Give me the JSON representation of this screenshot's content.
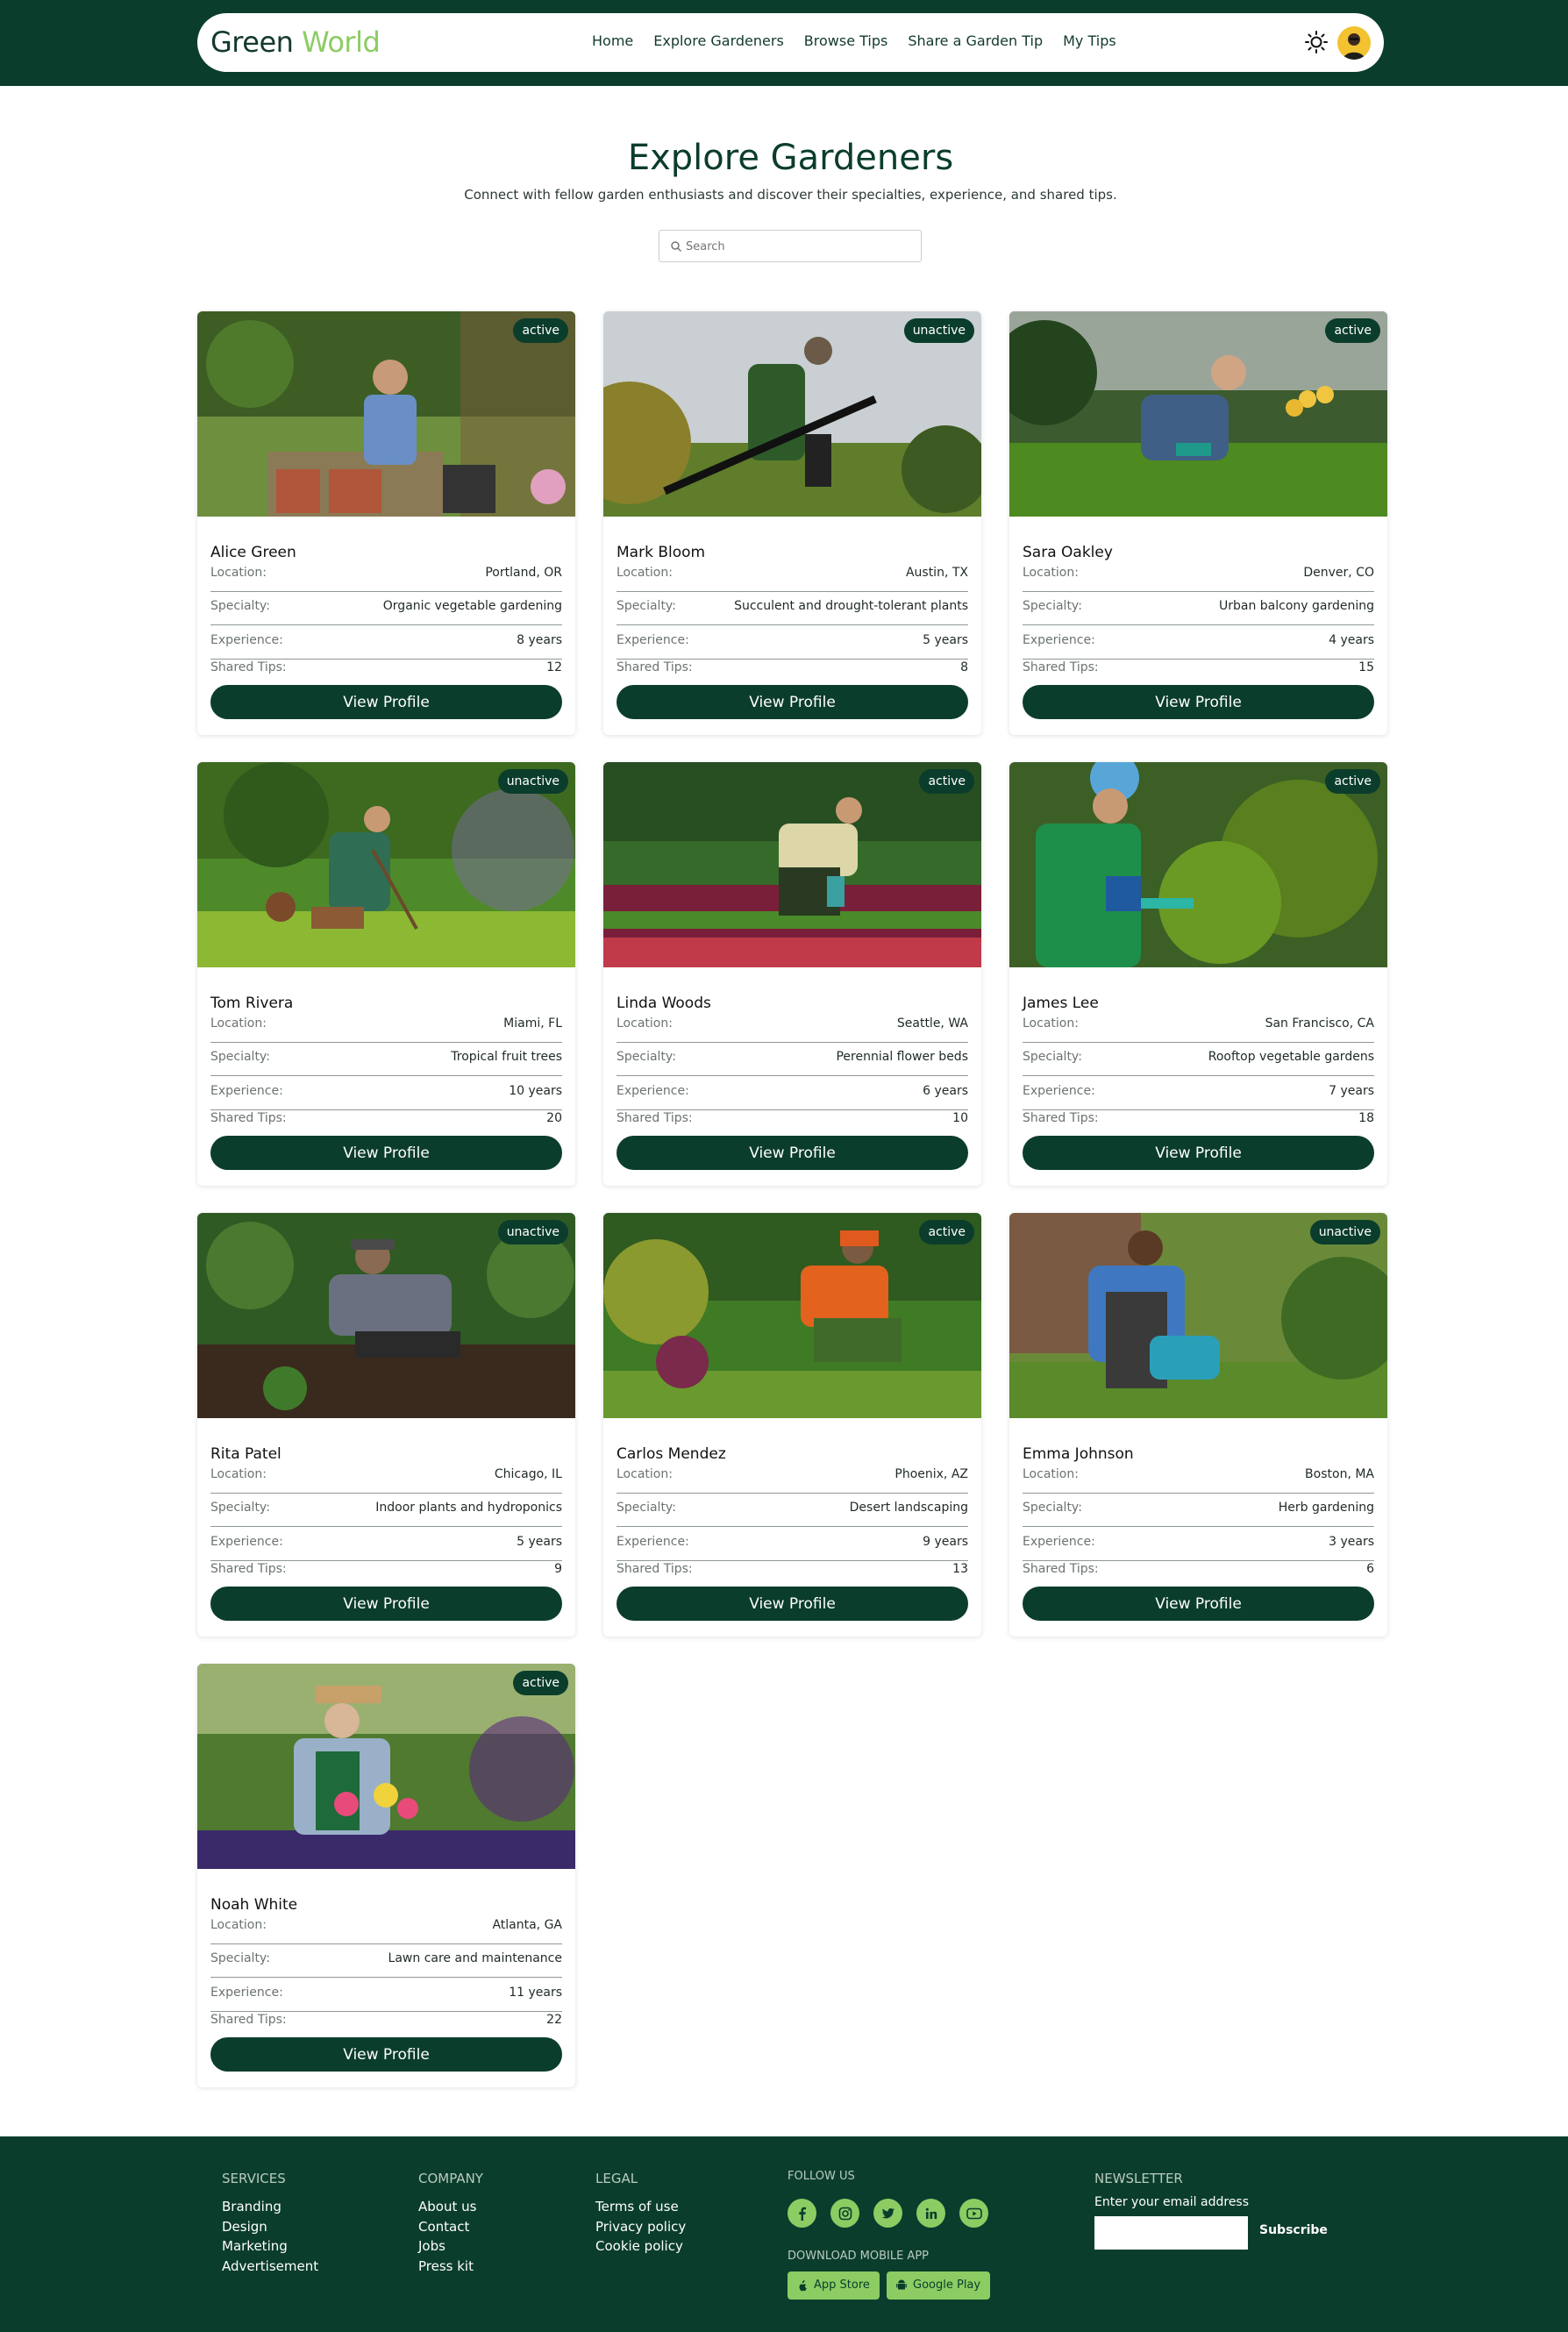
{
  "nav": {
    "logo_part1": "Green",
    "logo_part2": "World",
    "links": [
      "Home",
      "Explore Gardeners",
      "Browse Tips",
      "Share a Garden Tip",
      "My Tips"
    ],
    "theme_icon": "sun-icon",
    "avatar_icon": "user-avatar"
  },
  "header": {
    "title": "Explore Gardeners",
    "subtitle": "Connect with fellow garden enthusiasts and discover their specialties, experience, and shared tips.",
    "search_placeholder": "Search"
  },
  "labels": {
    "location": "Location:",
    "specialty": "Specialty:",
    "experience": "Experience:",
    "tips": "Shared Tips:",
    "button": "View Profile"
  },
  "gardeners": [
    {
      "name": "Alice Green",
      "status": "active",
      "location": "Portland, OR",
      "specialty": "Organic vegetable gardening",
      "experience": "8 years",
      "tips": "12"
    },
    {
      "name": "Mark Bloom",
      "status": "unactive",
      "location": "Austin, TX",
      "specialty": "Succulent and drought-tolerant plants",
      "experience": "5 years",
      "tips": "8"
    },
    {
      "name": "Sara Oakley",
      "status": "active",
      "location": "Denver, CO",
      "specialty": "Urban balcony gardening",
      "experience": "4 years",
      "tips": "15"
    },
    {
      "name": "Tom Rivera",
      "status": "unactive",
      "location": "Miami, FL",
      "specialty": "Tropical fruit trees",
      "experience": "10 years",
      "tips": "20"
    },
    {
      "name": "Linda Woods",
      "status": "active",
      "location": "Seattle, WA",
      "specialty": "Perennial flower beds",
      "experience": "6 years",
      "tips": "10"
    },
    {
      "name": "James Lee",
      "status": "active",
      "location": "San Francisco, CA",
      "specialty": "Rooftop vegetable gardens",
      "experience": "7 years",
      "tips": "18"
    },
    {
      "name": "Rita Patel",
      "status": "unactive",
      "location": "Chicago, IL",
      "specialty": "Indoor plants and hydroponics",
      "experience": "5 years",
      "tips": "9"
    },
    {
      "name": "Carlos Mendez",
      "status": "active",
      "location": "Phoenix, AZ",
      "specialty": "Desert landscaping",
      "experience": "9 years",
      "tips": "13"
    },
    {
      "name": "Emma Johnson",
      "status": "unactive",
      "location": "Boston, MA",
      "specialty": "Herb gardening",
      "experience": "3 years",
      "tips": "6"
    },
    {
      "name": "Noah White",
      "status": "active",
      "location": "Atlanta, GA",
      "specialty": "Lawn care and maintenance",
      "experience": "11 years",
      "tips": "22"
    }
  ],
  "footer": {
    "services": {
      "title": "SERVICES",
      "links": [
        "Branding",
        "Design",
        "Marketing",
        "Advertisement"
      ]
    },
    "company": {
      "title": "COMPANY",
      "links": [
        "About us",
        "Contact",
        "Jobs",
        "Press kit"
      ]
    },
    "legal": {
      "title": "LEGAL",
      "links": [
        "Terms of use",
        "Privacy policy",
        "Cookie policy"
      ]
    },
    "follow_title": "FOLLOW US",
    "socials": [
      "facebook-icon",
      "instagram-icon",
      "twitter-icon",
      "linkedin-icon",
      "youtube-icon"
    ],
    "download_title": "DOWNLOAD MOBILE APP",
    "app_store": "App Store",
    "google_play": "Google Play",
    "newsletter_title": "NEWSLETTER",
    "newsletter_label": "Enter your email address",
    "newsletter_button": "Subscribe"
  },
  "colors": {
    "primary": "#0b3d2c",
    "accent": "#8ccc63"
  }
}
